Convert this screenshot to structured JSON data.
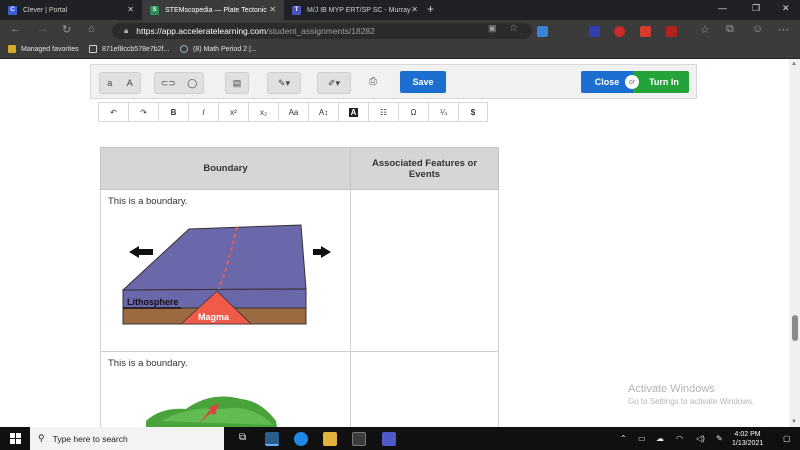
{
  "browser": {
    "tabs": [
      {
        "title": "Clever | Portal",
        "icon": "C",
        "color": "#3a5ed8"
      },
      {
        "title": "STEMscopedia — Plate Tectonic",
        "icon": "S",
        "color": "#2e8b57"
      },
      {
        "title": "M/J IB MYP ERT/SP SC - Murray",
        "icon": "T",
        "color": "#4b53bc"
      }
    ],
    "url_host": "https://app.acceleratelearning.com",
    "url_path": "/student_assignments/18282",
    "favorites": [
      {
        "label": "Managed favorites"
      },
      {
        "label": "871ef8ccb578e7b2f..."
      },
      {
        "label": "(8) Math Period 2 |..."
      }
    ]
  },
  "editor": {
    "save_label": "Save",
    "close_label": "Close",
    "or_label": "or",
    "turn_in_label": "Turn In",
    "text_size_small": "a",
    "text_size_large": "A",
    "format_buttons": [
      "↶",
      "↷",
      "B",
      "I",
      "x²",
      "x₂",
      "Aa",
      "A↕",
      "A",
      "☷",
      "Ω",
      "¼",
      "$"
    ]
  },
  "table": {
    "headers": [
      "Boundary",
      "Associated Features or Events"
    ],
    "rows": [
      {
        "text": "This is a  boundary.",
        "figure_labels": [
          "Lithosphere",
          "Magma"
        ]
      },
      {
        "text": "This is a  boundary."
      }
    ]
  },
  "watermark": {
    "title": "Activate Windows",
    "subtitle": "Go to Settings to activate Windows."
  },
  "taskbar": {
    "search_placeholder": "Type here to search",
    "time": "4:02 PM",
    "date": "1/13/2021"
  }
}
